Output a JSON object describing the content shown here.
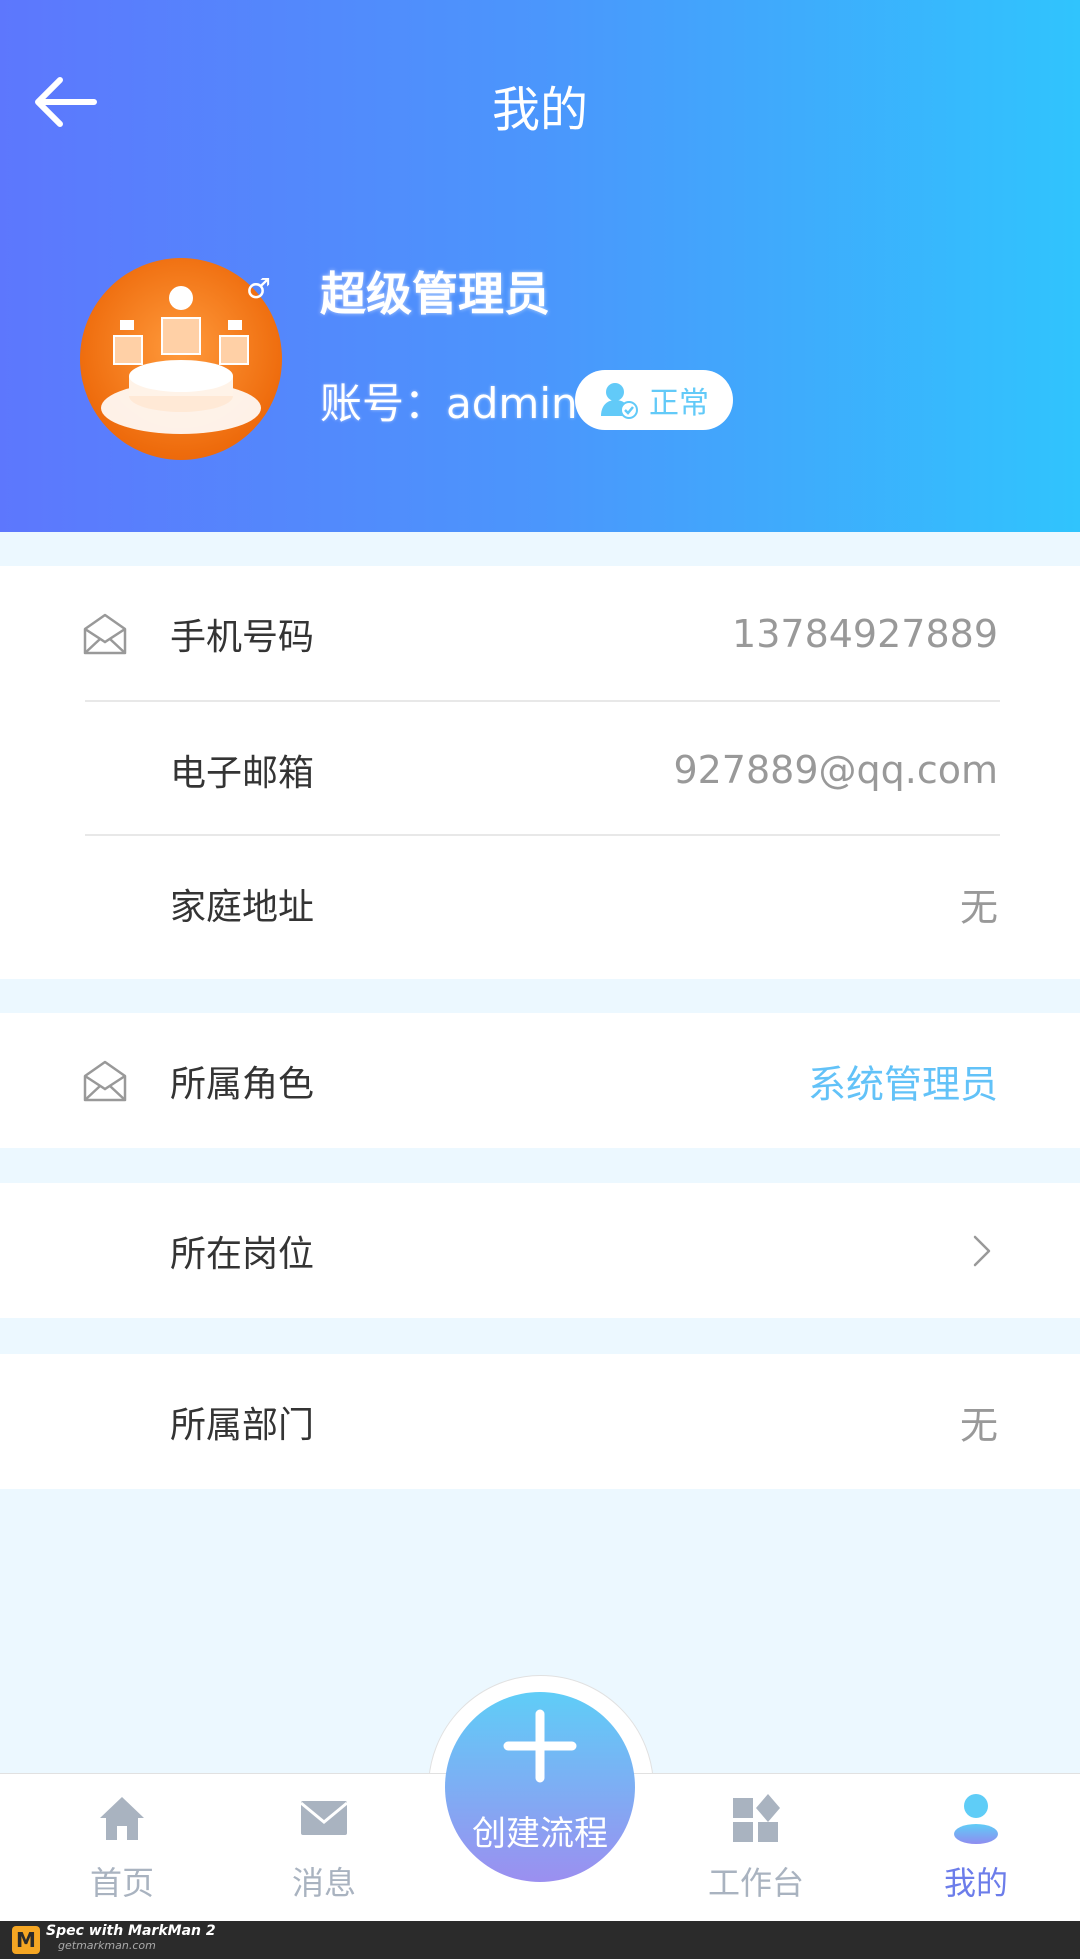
{
  "header": {
    "title": "我的",
    "name": "超级管理员",
    "account_prefix": "账号：",
    "account": "admin",
    "status": "正常",
    "colors": {
      "start": "#5d77fd",
      "mid": "#4b96fc",
      "end": "#30c4fd",
      "status_text": "#62caf8"
    }
  },
  "info": [
    {
      "label": "手机号码",
      "value": "13784927889"
    },
    {
      "label": "电子邮箱",
      "value": "927889@qq.com"
    },
    {
      "label": "家庭地址",
      "value": "无"
    }
  ],
  "role": {
    "label": "所属角色",
    "value": "系统管理员",
    "value_color": "#62c2f8"
  },
  "post": {
    "label": "所在岗位"
  },
  "dept": {
    "label": "所属部门",
    "value": "无"
  },
  "tabs": [
    {
      "label": "首页",
      "icon": "home-icon"
    },
    {
      "label": "消息",
      "icon": "mail-icon"
    },
    {
      "label": "工作台",
      "icon": "workbench-icon"
    },
    {
      "label": "我的",
      "icon": "user-icon",
      "active": true
    }
  ],
  "fab": {
    "label": "创建流程"
  },
  "footer": {
    "logo": "M",
    "line1": "Spec with MarkMan 2",
    "line2": "getmarkman.com"
  }
}
